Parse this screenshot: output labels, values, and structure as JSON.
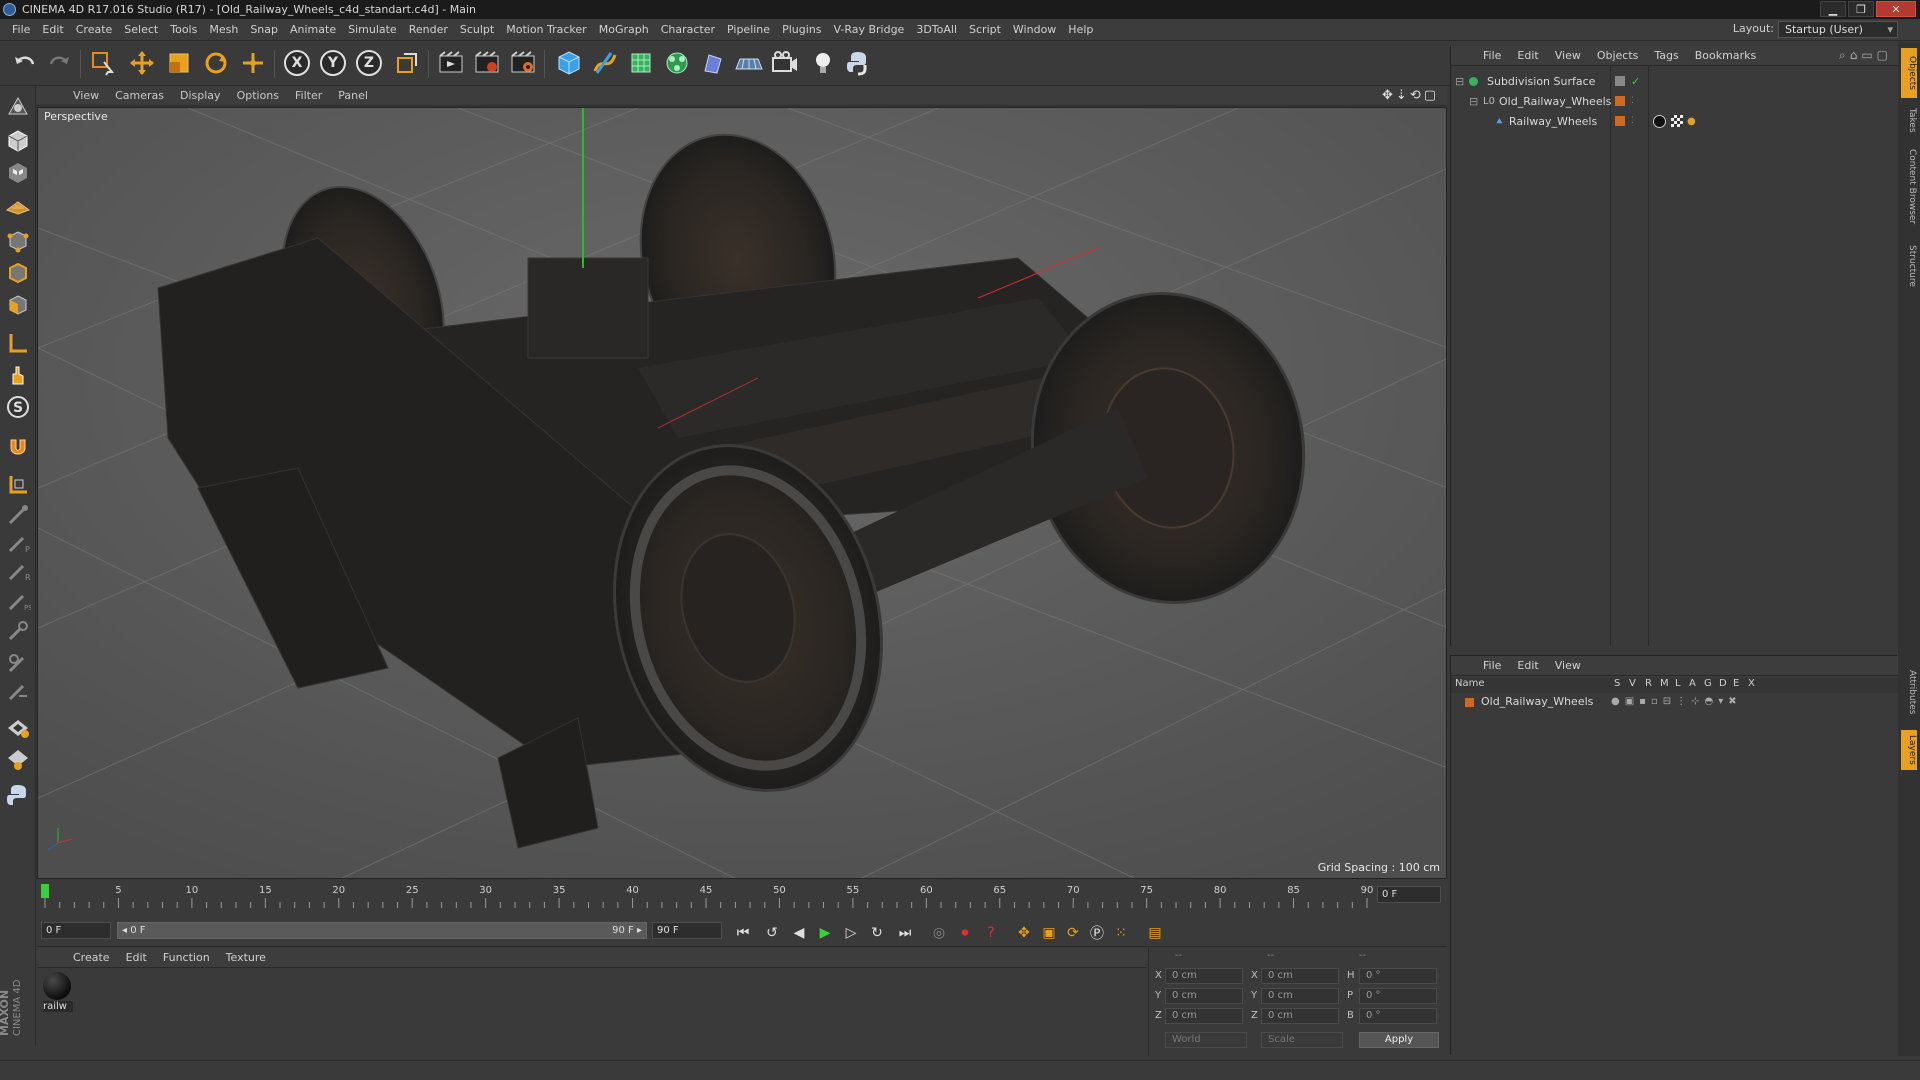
{
  "window": {
    "title": "CINEMA 4D R17.016 Studio (R17) - [Old_Railway_Wheels_c4d_standart.c4d] - Main",
    "buttons": [
      "▁",
      "❐",
      "✕"
    ]
  },
  "menubar": {
    "items": [
      "File",
      "Edit",
      "Create",
      "Select",
      "Tools",
      "Mesh",
      "Snap",
      "Animate",
      "Simulate",
      "Render",
      "Sculpt",
      "Motion Tracker",
      "MoGraph",
      "Character",
      "Pipeline",
      "Plugins",
      "V-Ray Bridge",
      "3DToAll",
      "Script",
      "Window",
      "Help"
    ],
    "layout_label": "Layout:",
    "layout_value": "Startup (User)"
  },
  "toolbar": {
    "axis_x": "X",
    "axis_y": "Y",
    "axis_z": "Z"
  },
  "viewport": {
    "menu": [
      "View",
      "Cameras",
      "Display",
      "Options",
      "Filter",
      "Panel"
    ],
    "label": "Perspective",
    "grid_spacing": "Grid Spacing : 100 cm"
  },
  "timeline": {
    "ticks": [
      "0",
      "5",
      "10",
      "15",
      "20",
      "25",
      "30",
      "35",
      "40",
      "45",
      "50",
      "55",
      "60",
      "65",
      "70",
      "75",
      "80",
      "85",
      "90"
    ],
    "current_frame": "0 F",
    "start_frame": "0 F",
    "range_start": "◂ 0 F",
    "range_end": "90 F ▸",
    "end_frame": "90 F"
  },
  "material_panel": {
    "menu": [
      "Create",
      "Edit",
      "Function",
      "Texture"
    ],
    "material_name": "railw"
  },
  "coordinates": {
    "header": [
      "--",
      "--",
      "--"
    ],
    "pos_labels": [
      "X",
      "Y",
      "Z"
    ],
    "size_labels": [
      "X",
      "Y",
      "Z"
    ],
    "rot_labels": [
      "H",
      "P",
      "B"
    ],
    "pos_values": [
      "0 cm",
      "0 cm",
      "0 cm"
    ],
    "size_values": [
      "0 cm",
      "0 cm",
      "0 cm"
    ],
    "rot_values": [
      "0 °",
      "0 °",
      "0 °"
    ],
    "world_select": "World",
    "scale_select": "Scale",
    "apply": "Apply"
  },
  "object_manager": {
    "menu": [
      "File",
      "Edit",
      "View",
      "Objects",
      "Tags",
      "Bookmarks"
    ],
    "objects": [
      {
        "name": "Subdivision Surface"
      },
      {
        "name": "Old_Railway_Wheels"
      },
      {
        "name": "Railway_Wheels"
      }
    ]
  },
  "layer_manager": {
    "menu": [
      "File",
      "Edit",
      "View"
    ],
    "columns": [
      "Name",
      "S",
      "V",
      "R",
      "M",
      "L",
      "A",
      "G",
      "D",
      "E",
      "X"
    ],
    "layers": [
      {
        "name": "Old_Railway_Wheels"
      }
    ]
  },
  "right_tabs": [
    "Objects",
    "Takes",
    "Content Browser",
    "Structure",
    "Attributes",
    "Layers"
  ],
  "branding": {
    "line1": "MAXON",
    "line2": "CINEMA 4D"
  },
  "colors": {
    "accent_orange": "#e88a1a",
    "layer_orange": "#d2691e",
    "green_axis": "#22c022",
    "red_axis": "#d03030"
  }
}
